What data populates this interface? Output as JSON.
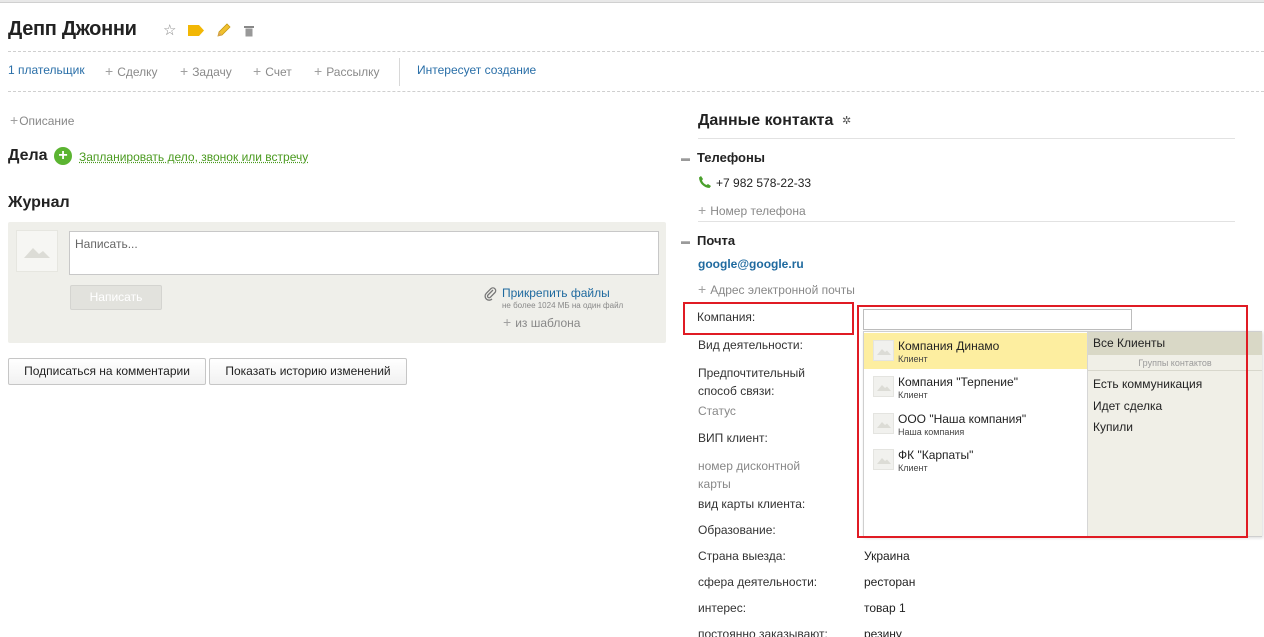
{
  "header": {
    "title": "Депп Джонни"
  },
  "actions": {
    "payer": "1 плательщик",
    "deal": "Сделку",
    "task": "Задачу",
    "invoice": "Счет",
    "mailing": "Рассылку",
    "interest": "Интересует создание"
  },
  "left": {
    "description": "Описание",
    "tasks_title": "Дела",
    "tasks_link": "Запланировать дело, звонок или встречу",
    "journal_title": "Журнал",
    "journal_placeholder": "Написать...",
    "write_button": "Написать",
    "attach_link": "Прикрепить файлы",
    "attach_note": "не более 1024 МБ на один файл",
    "from_template": "из шаблона",
    "subscribe_button": "Подписаться на комментарии",
    "history_button": "Показать историю изменений"
  },
  "contact": {
    "title": "Данные контакта",
    "phones_title": "Телефоны",
    "phone": "+7 982 578-22-33",
    "add_phone": "Номер телефона",
    "mail_title": "Почта",
    "email": "google@google.ru",
    "add_email": "Адрес электронной почты",
    "fields": [
      {
        "label": "Компания:",
        "value": ""
      },
      {
        "label": "Вид деятельности:",
        "value": ""
      },
      {
        "label": "Предпочтительный способ связи:",
        "value": ""
      },
      {
        "label": "Статус",
        "value": ""
      },
      {
        "label": "ВИП клиент:",
        "value": ""
      },
      {
        "label": "номер дисконтной карты",
        "value": ""
      },
      {
        "label": "вид карты клиента:",
        "value": ""
      },
      {
        "label": "Образование:",
        "value": ""
      },
      {
        "label": "Страна выезда:",
        "value": "Украина"
      },
      {
        "label": "сфера деятельности:",
        "value": "ресторан"
      },
      {
        "label": "интерес:",
        "value": "товар 1"
      },
      {
        "label": "постоянно заказывают:",
        "value": "резину"
      }
    ]
  },
  "dropdown": {
    "input_value": "",
    "items": [
      {
        "name": "Компания Динамо",
        "sub": "Клиент",
        "selected": true
      },
      {
        "name": "Компания \"Терпение\"",
        "sub": "Клиент",
        "selected": false
      },
      {
        "name": "ООО \"Наша компания\"",
        "sub": "Наша компания",
        "selected": false
      },
      {
        "name": "ФК \"Карпаты\"",
        "sub": "Клиент",
        "selected": false
      }
    ],
    "right_head": "Все Клиенты",
    "group_label": "Группы контактов",
    "groups": [
      "Есть коммуникация",
      "Идет сделка",
      "Купили"
    ]
  },
  "colors": {
    "accent_blue": "#1f6a9f",
    "green": "#5bb431",
    "highlight": "#fdeea0",
    "annotation_red": "#e01b24"
  }
}
